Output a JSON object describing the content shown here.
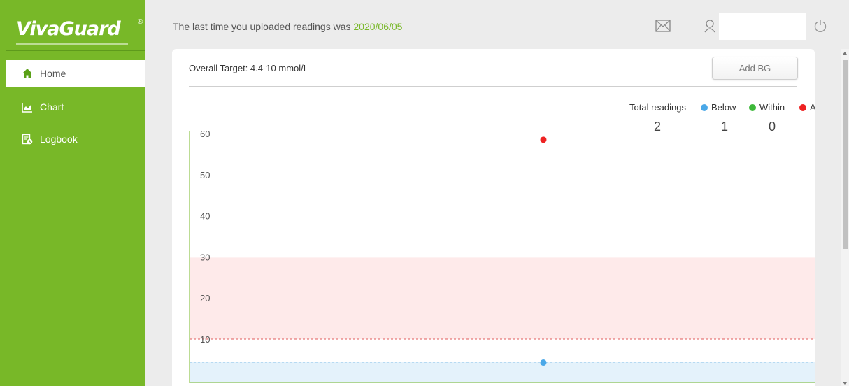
{
  "app": {
    "logo_text": "VivaGuard",
    "logo_mark": "®"
  },
  "sidebar": {
    "items": [
      {
        "label": "Home",
        "icon": "home-icon",
        "active": true
      },
      {
        "label": "Chart",
        "icon": "chart-icon",
        "active": false
      },
      {
        "label": "Logbook",
        "icon": "logbook-icon",
        "active": false
      }
    ]
  },
  "header": {
    "message": "The last time you uploaded readings was ",
    "last_upload_date": "2020/06/05",
    "user_value": ""
  },
  "main": {
    "target_label": "Overall Target: 4.4-10 mmol/L",
    "add_bg_label": "Add BG",
    "summary": {
      "total_label": "Total readings",
      "total_value": "2",
      "below_label": "Below",
      "below_value": "1",
      "within_label": "Within",
      "within_value": "0",
      "above_label": "A"
    }
  },
  "colors": {
    "brand_green": "#78b828",
    "below": "#4aa8e8",
    "within": "#3db83a",
    "above": "#ee2222",
    "above_band": "#feeaea",
    "below_band": "#e4f2fb"
  },
  "chart_data": {
    "type": "scatter",
    "ylim": [
      0,
      60
    ],
    "y_ticks": [
      60,
      50,
      40,
      30,
      20,
      10
    ],
    "target_high": 10,
    "target_low": 4.4,
    "points": [
      {
        "y": 58.5,
        "category": "above"
      },
      {
        "y": 4.3,
        "category": "below"
      }
    ]
  }
}
